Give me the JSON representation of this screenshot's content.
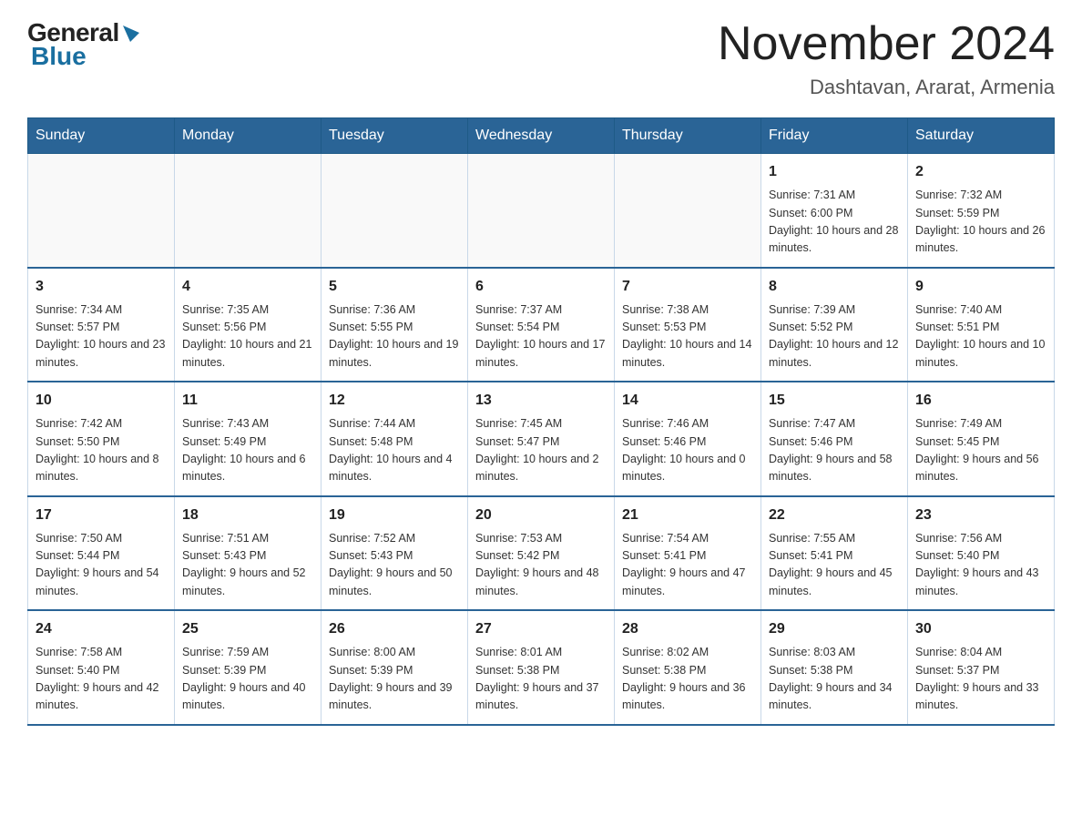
{
  "header": {
    "logo_general": "General",
    "logo_blue": "Blue",
    "main_title": "November 2024",
    "subtitle": "Dashtavan, Ararat, Armenia"
  },
  "calendar": {
    "days_of_week": [
      "Sunday",
      "Monday",
      "Tuesday",
      "Wednesday",
      "Thursday",
      "Friday",
      "Saturday"
    ],
    "weeks": [
      [
        {
          "day": "",
          "info": ""
        },
        {
          "day": "",
          "info": ""
        },
        {
          "day": "",
          "info": ""
        },
        {
          "day": "",
          "info": ""
        },
        {
          "day": "",
          "info": ""
        },
        {
          "day": "1",
          "info": "Sunrise: 7:31 AM\nSunset: 6:00 PM\nDaylight: 10 hours and 28 minutes."
        },
        {
          "day": "2",
          "info": "Sunrise: 7:32 AM\nSunset: 5:59 PM\nDaylight: 10 hours and 26 minutes."
        }
      ],
      [
        {
          "day": "3",
          "info": "Sunrise: 7:34 AM\nSunset: 5:57 PM\nDaylight: 10 hours and 23 minutes."
        },
        {
          "day": "4",
          "info": "Sunrise: 7:35 AM\nSunset: 5:56 PM\nDaylight: 10 hours and 21 minutes."
        },
        {
          "day": "5",
          "info": "Sunrise: 7:36 AM\nSunset: 5:55 PM\nDaylight: 10 hours and 19 minutes."
        },
        {
          "day": "6",
          "info": "Sunrise: 7:37 AM\nSunset: 5:54 PM\nDaylight: 10 hours and 17 minutes."
        },
        {
          "day": "7",
          "info": "Sunrise: 7:38 AM\nSunset: 5:53 PM\nDaylight: 10 hours and 14 minutes."
        },
        {
          "day": "8",
          "info": "Sunrise: 7:39 AM\nSunset: 5:52 PM\nDaylight: 10 hours and 12 minutes."
        },
        {
          "day": "9",
          "info": "Sunrise: 7:40 AM\nSunset: 5:51 PM\nDaylight: 10 hours and 10 minutes."
        }
      ],
      [
        {
          "day": "10",
          "info": "Sunrise: 7:42 AM\nSunset: 5:50 PM\nDaylight: 10 hours and 8 minutes."
        },
        {
          "day": "11",
          "info": "Sunrise: 7:43 AM\nSunset: 5:49 PM\nDaylight: 10 hours and 6 minutes."
        },
        {
          "day": "12",
          "info": "Sunrise: 7:44 AM\nSunset: 5:48 PM\nDaylight: 10 hours and 4 minutes."
        },
        {
          "day": "13",
          "info": "Sunrise: 7:45 AM\nSunset: 5:47 PM\nDaylight: 10 hours and 2 minutes."
        },
        {
          "day": "14",
          "info": "Sunrise: 7:46 AM\nSunset: 5:46 PM\nDaylight: 10 hours and 0 minutes."
        },
        {
          "day": "15",
          "info": "Sunrise: 7:47 AM\nSunset: 5:46 PM\nDaylight: 9 hours and 58 minutes."
        },
        {
          "day": "16",
          "info": "Sunrise: 7:49 AM\nSunset: 5:45 PM\nDaylight: 9 hours and 56 minutes."
        }
      ],
      [
        {
          "day": "17",
          "info": "Sunrise: 7:50 AM\nSunset: 5:44 PM\nDaylight: 9 hours and 54 minutes."
        },
        {
          "day": "18",
          "info": "Sunrise: 7:51 AM\nSunset: 5:43 PM\nDaylight: 9 hours and 52 minutes."
        },
        {
          "day": "19",
          "info": "Sunrise: 7:52 AM\nSunset: 5:43 PM\nDaylight: 9 hours and 50 minutes."
        },
        {
          "day": "20",
          "info": "Sunrise: 7:53 AM\nSunset: 5:42 PM\nDaylight: 9 hours and 48 minutes."
        },
        {
          "day": "21",
          "info": "Sunrise: 7:54 AM\nSunset: 5:41 PM\nDaylight: 9 hours and 47 minutes."
        },
        {
          "day": "22",
          "info": "Sunrise: 7:55 AM\nSunset: 5:41 PM\nDaylight: 9 hours and 45 minutes."
        },
        {
          "day": "23",
          "info": "Sunrise: 7:56 AM\nSunset: 5:40 PM\nDaylight: 9 hours and 43 minutes."
        }
      ],
      [
        {
          "day": "24",
          "info": "Sunrise: 7:58 AM\nSunset: 5:40 PM\nDaylight: 9 hours and 42 minutes."
        },
        {
          "day": "25",
          "info": "Sunrise: 7:59 AM\nSunset: 5:39 PM\nDaylight: 9 hours and 40 minutes."
        },
        {
          "day": "26",
          "info": "Sunrise: 8:00 AM\nSunset: 5:39 PM\nDaylight: 9 hours and 39 minutes."
        },
        {
          "day": "27",
          "info": "Sunrise: 8:01 AM\nSunset: 5:38 PM\nDaylight: 9 hours and 37 minutes."
        },
        {
          "day": "28",
          "info": "Sunrise: 8:02 AM\nSunset: 5:38 PM\nDaylight: 9 hours and 36 minutes."
        },
        {
          "day": "29",
          "info": "Sunrise: 8:03 AM\nSunset: 5:38 PM\nDaylight: 9 hours and 34 minutes."
        },
        {
          "day": "30",
          "info": "Sunrise: 8:04 AM\nSunset: 5:37 PM\nDaylight: 9 hours and 33 minutes."
        }
      ]
    ]
  }
}
